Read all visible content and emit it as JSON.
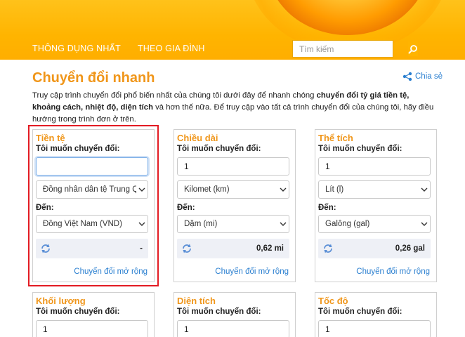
{
  "nav": {
    "items": [
      "THÔNG DỤNG NHẤT",
      "THEO GIA ĐÌNH"
    ],
    "search_placeholder": "Tìm kiếm"
  },
  "page": {
    "title": "Chuyển đổi nhanh",
    "share": "Chia sẻ",
    "intro": {
      "p1": "Truy cập trình chuyển đổi phổ biến nhất của chúng tôi dưới đây để nhanh chóng ",
      "b1": "chuyển đổi tỷ giá tiền tệ, khoảng cách, nhiệt độ, diện tích",
      "p2": " và hơn thế nữa. Để truy cập vào tất cả trình chuyển đổi của chúng tôi, hãy điều hướng trong trình đơn ở trên."
    }
  },
  "labels": {
    "want": "Tôi muốn chuyển đổi:",
    "to": "Đến:",
    "more": "Chuyển đổi mở rộng"
  },
  "cards": [
    {
      "title": "Tiền tệ",
      "input": "",
      "from": "Đồng nhân dân tệ Trung Quốc",
      "to": "Đồng Việt Nam (VND)",
      "result": "-"
    },
    {
      "title": "Chiều dài",
      "input": "1",
      "from": "Kilomet (km)",
      "to": "Dặm (mi)",
      "result": "0,62 mi"
    },
    {
      "title": "Thể tích",
      "input": "1",
      "from": "Lít (l)",
      "to": "Galông (gal)",
      "result": "0,26 gal"
    }
  ],
  "bottom_cards": [
    {
      "title": "Khối lượng",
      "input": "1"
    },
    {
      "title": "Diện tích",
      "input": "1"
    },
    {
      "title": "Tốc độ",
      "input": "1"
    }
  ],
  "colors": {
    "header": "#ffb400",
    "accent": "#f0961a",
    "link": "#2a7fd0",
    "highlight": "#e31b23"
  }
}
